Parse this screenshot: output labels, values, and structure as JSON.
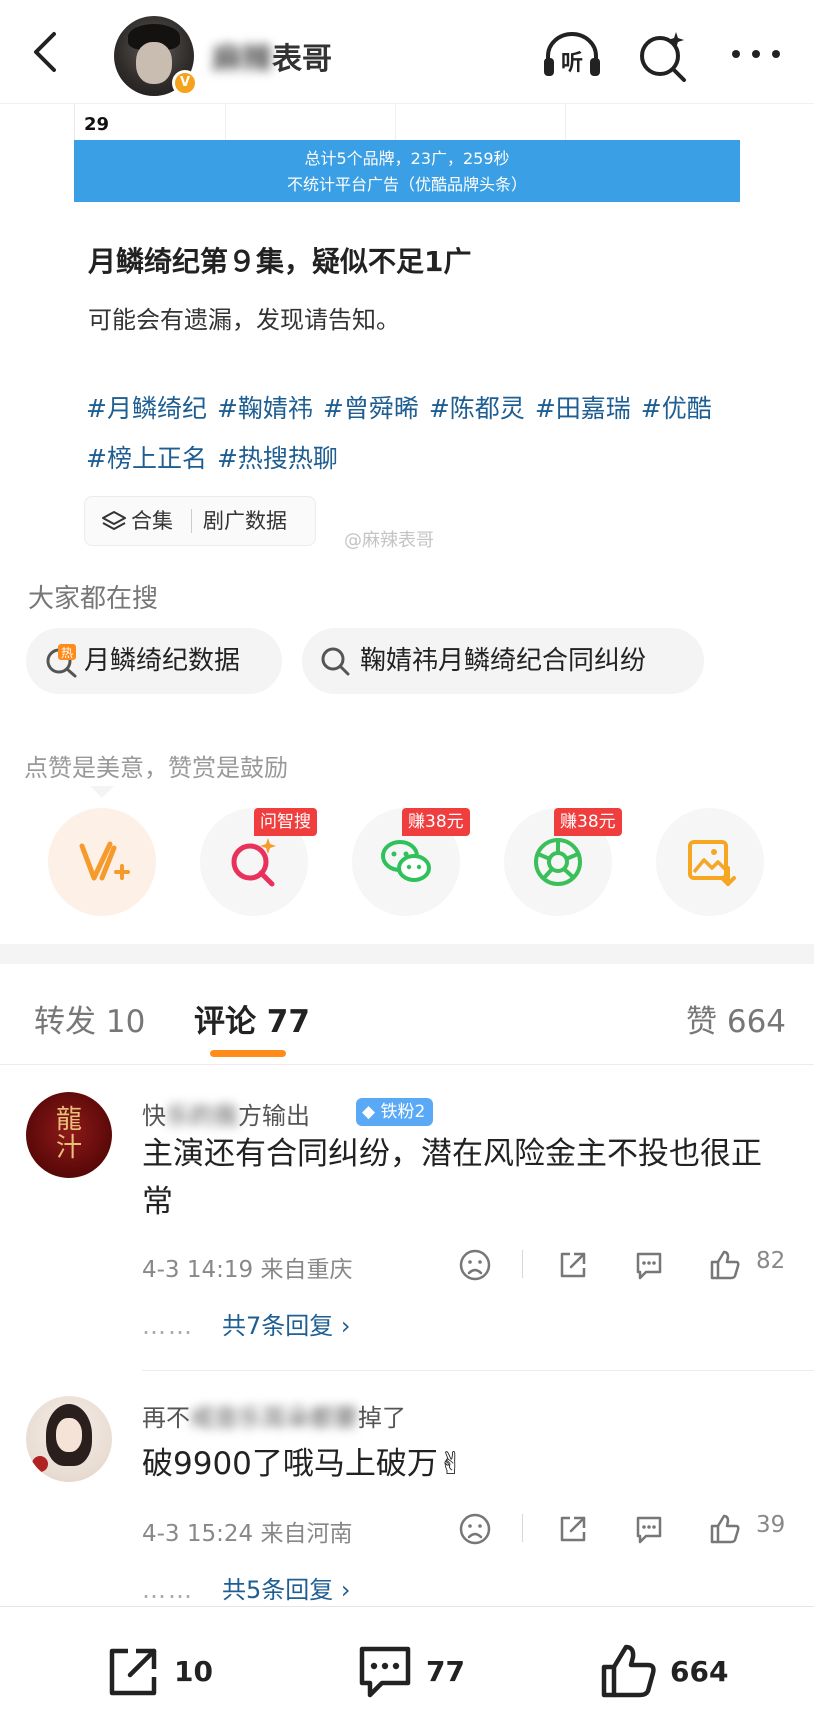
{
  "header": {
    "account_name_blurred": "麻辣",
    "account_name_suffix": "表哥",
    "verified_badge": "V",
    "icons": [
      "back-icon",
      "listen-icon",
      "search-spark-icon",
      "more-icon"
    ],
    "listen_label": "听"
  },
  "image": {
    "row_number": "29",
    "banner_line1": "总计5个品牌，23广，259秒",
    "banner_line2": "不统计平台广告（优酷品牌头条）"
  },
  "post": {
    "title": "月鳞绮纪第９集，疑似不足1广",
    "subtitle": "可能会有遗漏，发现请告知。",
    "hashtags": [
      "#月鳞绮纪",
      "#鞠婧祎",
      "#曾舜晞",
      "#陈都灵",
      "#田嘉瑞",
      "#优酷",
      "#榜上正名",
      "#热搜热聊"
    ],
    "collection_label": "合集",
    "collection_name": "剧广数据",
    "watermark": "@麻辣表哥"
  },
  "searching": {
    "heading": "大家都在搜",
    "items": [
      "月鳞绮纪数据",
      "鞠婧祎月鳞绮纪合同纠纷"
    ]
  },
  "tip": "点赞是美意，赞赏是鼓励",
  "actions": [
    {
      "name": "vplus",
      "badge": ""
    },
    {
      "name": "ask-search",
      "badge": "问智搜"
    },
    {
      "name": "wechat",
      "badge": "赚38元"
    },
    {
      "name": "moments",
      "badge": "赚38元"
    },
    {
      "name": "save-image",
      "badge": ""
    }
  ],
  "colors": {
    "accent": "#ff8c1a",
    "link": "#1f5e92",
    "banner": "#3a9fe4",
    "badge_red": "#f03e3e"
  },
  "tabs": {
    "repost": "转发 10",
    "comments": "评论 77",
    "likes": "赞 664"
  },
  "comments": [
    {
      "name_blurred_start": "快",
      "name_blurred_mid": "乐的我",
      "name_end": "方输出",
      "fan_badge": "铁粉2",
      "text": "主演还有合同纠纷，潜在风险金主不投也很正常",
      "meta": "4-3 14:19  来自重庆",
      "likes": "82",
      "replies": "共7条回复 ›",
      "dots": "……"
    },
    {
      "name_blurred_start": "再不",
      "name_blurred_mid": "戒音乐耳朵都要",
      "name_end": "掉了",
      "text": "破9900了哦马上破万✌",
      "meta": "4-3 15:24  来自河南",
      "likes": "39",
      "replies": "共5条回复 ›",
      "dots": "……"
    }
  ],
  "bottom": {
    "repost_count": "10",
    "comment_count": "77",
    "like_count": "664"
  }
}
